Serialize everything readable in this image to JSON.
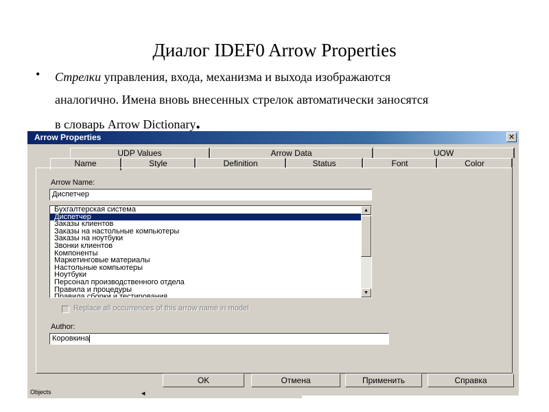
{
  "slide": {
    "title": "Диалог IDEF0 Arrow Properties",
    "bullet": {
      "italic": "Стрелки",
      "text_line1": " управления, входа, механизма и выхода изображаются",
      "text_line2": "аналогично. Имена вновь внесенных стрелок автоматически заносятся",
      "text_line3": "в словарь Arrow Dictionary",
      "end_mark": "."
    }
  },
  "dialog": {
    "title": "Arrow Properties",
    "close_label": "✕",
    "tabs_back": [
      "UDP Values",
      "Arrow Data",
      "UOW"
    ],
    "tabs_front": [
      "Name",
      "Style",
      "Definition",
      "Status",
      "Font",
      "Color"
    ],
    "active_tab": "Name",
    "arrow_name_label": "Arrow Name:",
    "arrow_name_value": "Диспетчер",
    "list_items": [
      "Бухгалтерская система",
      "Диспетчер",
      "Заказы клиентов",
      "Заказы на настольные компьютеры",
      "Заказы на ноутбуки",
      "Звонки клиентов",
      "Компоненты",
      "Маркетинговые материалы",
      "Настольные компьютеры",
      "Ноутбуки",
      "Персонал производственного отдела",
      "Правила и процедуры",
      "Правила сборки и тестирования"
    ],
    "selected_item": "Диспетчер",
    "replace_checkbox_label": "Replace all occurrences of this arrow name in model",
    "replace_checked": false,
    "author_label": "Author:",
    "author_value": "Коровкина",
    "buttons": {
      "ok": "OK",
      "cancel": "Отмена",
      "apply": "Применить",
      "help": "Справка"
    }
  },
  "taskbar": {
    "objects_label": "Objects"
  },
  "colors": {
    "dialog_face": "#d4d0c8",
    "titlebar": "#0a246a",
    "selection": "#0a246a"
  }
}
